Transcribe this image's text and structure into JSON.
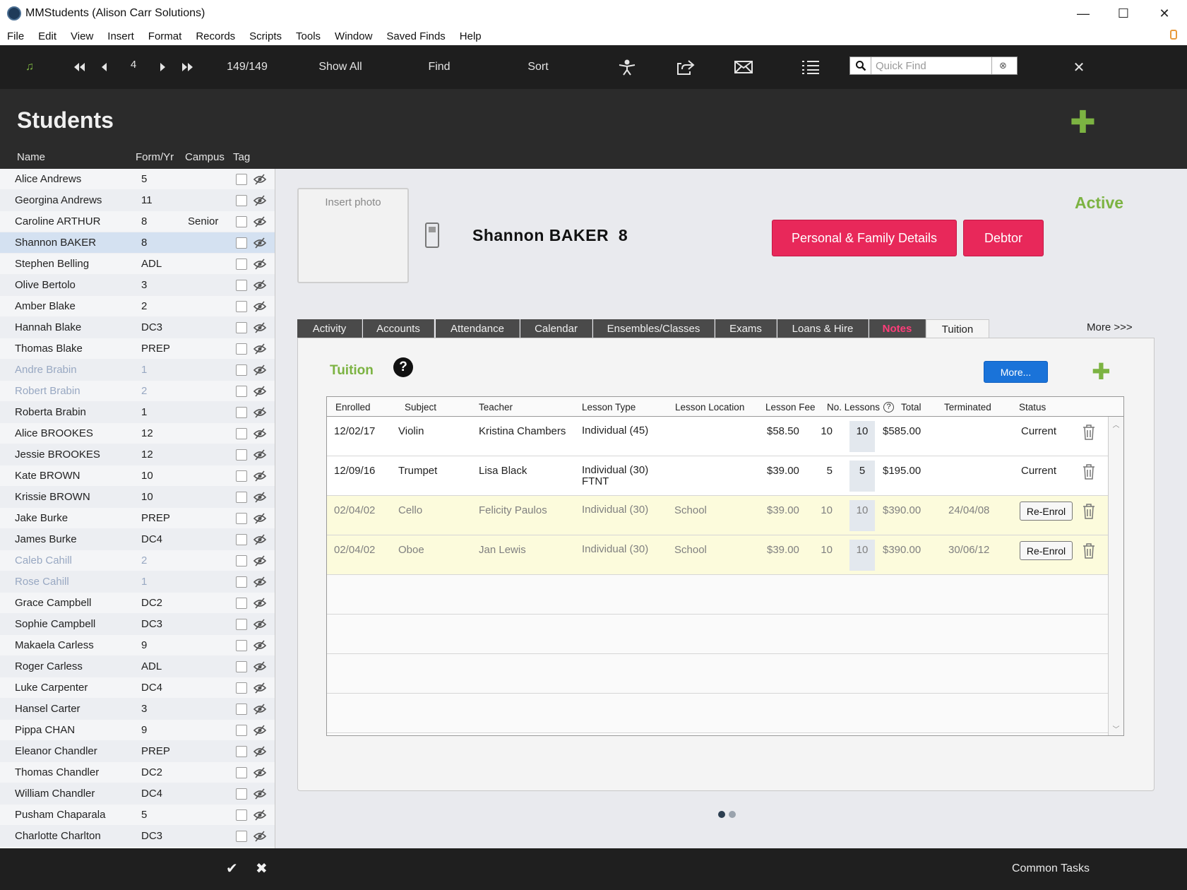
{
  "window": {
    "title": "MMStudents (Alison Carr Solutions)",
    "controls": {
      "minimize": "—",
      "maximize": "☐",
      "close": "✕"
    }
  },
  "menu": [
    "File",
    "Edit",
    "View",
    "Insert",
    "Format",
    "Records",
    "Scripts",
    "Tools",
    "Window",
    "Saved Finds",
    "Help"
  ],
  "toolbar": {
    "record_number": "4",
    "record_count": "149/149",
    "show_all": "Show All",
    "find": "Find",
    "sort": "Sort",
    "quick_find_placeholder": "Quick Find",
    "close": "✕"
  },
  "header": {
    "title": "Students",
    "columns": {
      "name": "Name",
      "form": "Form/Yr",
      "campus": "Campus",
      "tag": "Tag"
    }
  },
  "students": [
    {
      "name": "Alice Andrews",
      "form": "5",
      "campus": "",
      "inactive": false
    },
    {
      "name": "Georgina Andrews",
      "form": "11",
      "campus": "",
      "inactive": false
    },
    {
      "name": "Caroline ARTHUR",
      "form": "8",
      "campus": "Senior",
      "inactive": false
    },
    {
      "name": "Shannon BAKER",
      "form": "8",
      "campus": "",
      "inactive": false,
      "selected": true
    },
    {
      "name": "Stephen Belling",
      "form": "ADL",
      "campus": "",
      "inactive": false
    },
    {
      "name": "Olive Bertolo",
      "form": "3",
      "campus": "",
      "inactive": false
    },
    {
      "name": "Amber Blake",
      "form": "2",
      "campus": "",
      "inactive": false
    },
    {
      "name": "Hannah Blake",
      "form": "DC3",
      "campus": "",
      "inactive": false
    },
    {
      "name": "Thomas Blake",
      "form": "PREP",
      "campus": "",
      "inactive": false
    },
    {
      "name": "Andre Brabin",
      "form": "1",
      "campus": "",
      "inactive": true
    },
    {
      "name": "Robert Brabin",
      "form": "2",
      "campus": "",
      "inactive": true
    },
    {
      "name": "Roberta Brabin",
      "form": "1",
      "campus": "",
      "inactive": false
    },
    {
      "name": "Alice BROOKES",
      "form": "12",
      "campus": "",
      "inactive": false
    },
    {
      "name": "Jessie BROOKES",
      "form": "12",
      "campus": "",
      "inactive": false
    },
    {
      "name": "Kate BROWN",
      "form": "10",
      "campus": "",
      "inactive": false
    },
    {
      "name": "Krissie BROWN",
      "form": "10",
      "campus": "",
      "inactive": false
    },
    {
      "name": "Jake Burke",
      "form": "PREP",
      "campus": "",
      "inactive": false
    },
    {
      "name": "James Burke",
      "form": "DC4",
      "campus": "",
      "inactive": false
    },
    {
      "name": "Caleb Cahill",
      "form": "2",
      "campus": "",
      "inactive": true
    },
    {
      "name": "Rose Cahill",
      "form": "1",
      "campus": "",
      "inactive": true
    },
    {
      "name": "Grace Campbell",
      "form": "DC2",
      "campus": "",
      "inactive": false
    },
    {
      "name": "Sophie Campbell",
      "form": "DC3",
      "campus": "",
      "inactive": false
    },
    {
      "name": "Makaela Carless",
      "form": "9",
      "campus": "",
      "inactive": false
    },
    {
      "name": "Roger Carless",
      "form": "ADL",
      "campus": "",
      "inactive": false
    },
    {
      "name": "Luke Carpenter",
      "form": "DC4",
      "campus": "",
      "inactive": false
    },
    {
      "name": "Hansel Carter",
      "form": "3",
      "campus": "",
      "inactive": false
    },
    {
      "name": "Pippa CHAN",
      "form": "9",
      "campus": "",
      "inactive": false
    },
    {
      "name": "Eleanor Chandler",
      "form": "PREP",
      "campus": "",
      "inactive": false
    },
    {
      "name": "Thomas Chandler",
      "form": "DC2",
      "campus": "",
      "inactive": false
    },
    {
      "name": "William Chandler",
      "form": "DC4",
      "campus": "",
      "inactive": false
    },
    {
      "name": "Pusham Chaparala",
      "form": "5",
      "campus": "",
      "inactive": false
    },
    {
      "name": "Charlotte Charlton",
      "form": "DC3",
      "campus": "",
      "inactive": false
    }
  ],
  "detail": {
    "photo_placeholder": "Insert photo",
    "student_name": "Shannon BAKER  8",
    "personal_button": "Personal & Family Details",
    "debtor_button": "Debtor",
    "status": "Active"
  },
  "tabs": [
    "Activity",
    "Accounts",
    "Attendance",
    "Calendar",
    "Ensembles/Classes",
    "Exams",
    "Loans & Hire",
    "Notes",
    "Tuition"
  ],
  "more_tabs": "More >>>",
  "tuition": {
    "label": "Tuition",
    "help": "?",
    "more_button": "More...",
    "columns": {
      "enrolled": "Enrolled",
      "subject": "Subject",
      "teacher": "Teacher",
      "lesson_type": "Lesson Type",
      "location": "Lesson Location",
      "fee": "Lesson Fee",
      "lessons": "No. Lessons",
      "lessons_help": "?",
      "total": "Total",
      "terminated": "Terminated",
      "status": "Status"
    },
    "rows": [
      {
        "enrolled": "12/02/17",
        "subject": "Violin",
        "teacher": "Kristina Chambers",
        "lesson_type": "Individual (45)",
        "lesson_type2": "",
        "location": "",
        "fee": "$58.50",
        "lessons": "10",
        "lessons_box": "10",
        "total": "$585.00",
        "terminated": "",
        "status": "Current",
        "terminated_row": false
      },
      {
        "enrolled": "12/09/16",
        "subject": "Trumpet",
        "teacher": "Lisa Black",
        "lesson_type": "Individual (30)",
        "lesson_type2": "FTNT",
        "location": "",
        "fee": "$39.00",
        "lessons": "5",
        "lessons_box": "5",
        "total": "$195.00",
        "terminated": "",
        "status": "Current",
        "terminated_row": false
      },
      {
        "enrolled": "02/04/02",
        "subject": "Cello",
        "teacher": "Felicity Paulos",
        "lesson_type": "Individual (30)",
        "lesson_type2": "",
        "location": "School",
        "fee": "$39.00",
        "lessons": "10",
        "lessons_box": "10",
        "total": "$390.00",
        "terminated": "24/04/08",
        "status": "Re-Enrol",
        "terminated_row": true
      },
      {
        "enrolled": "02/04/02",
        "subject": "Oboe",
        "teacher": "Jan Lewis",
        "lesson_type": "Individual (30)",
        "lesson_type2": "",
        "location": "School",
        "fee": "$39.00",
        "lessons": "10",
        "lessons_box": "10",
        "total": "$390.00",
        "terminated": "30/06/12",
        "status": "Re-Enrol",
        "terminated_row": true
      }
    ]
  },
  "footer": {
    "ok": "✔",
    "cancel": "✖",
    "common_tasks": "Common Tasks"
  },
  "colors": {
    "accent_green": "#7cb342",
    "pink": "#e8285a",
    "blue": "#1a73d9",
    "dark": "#1e1e1e"
  }
}
